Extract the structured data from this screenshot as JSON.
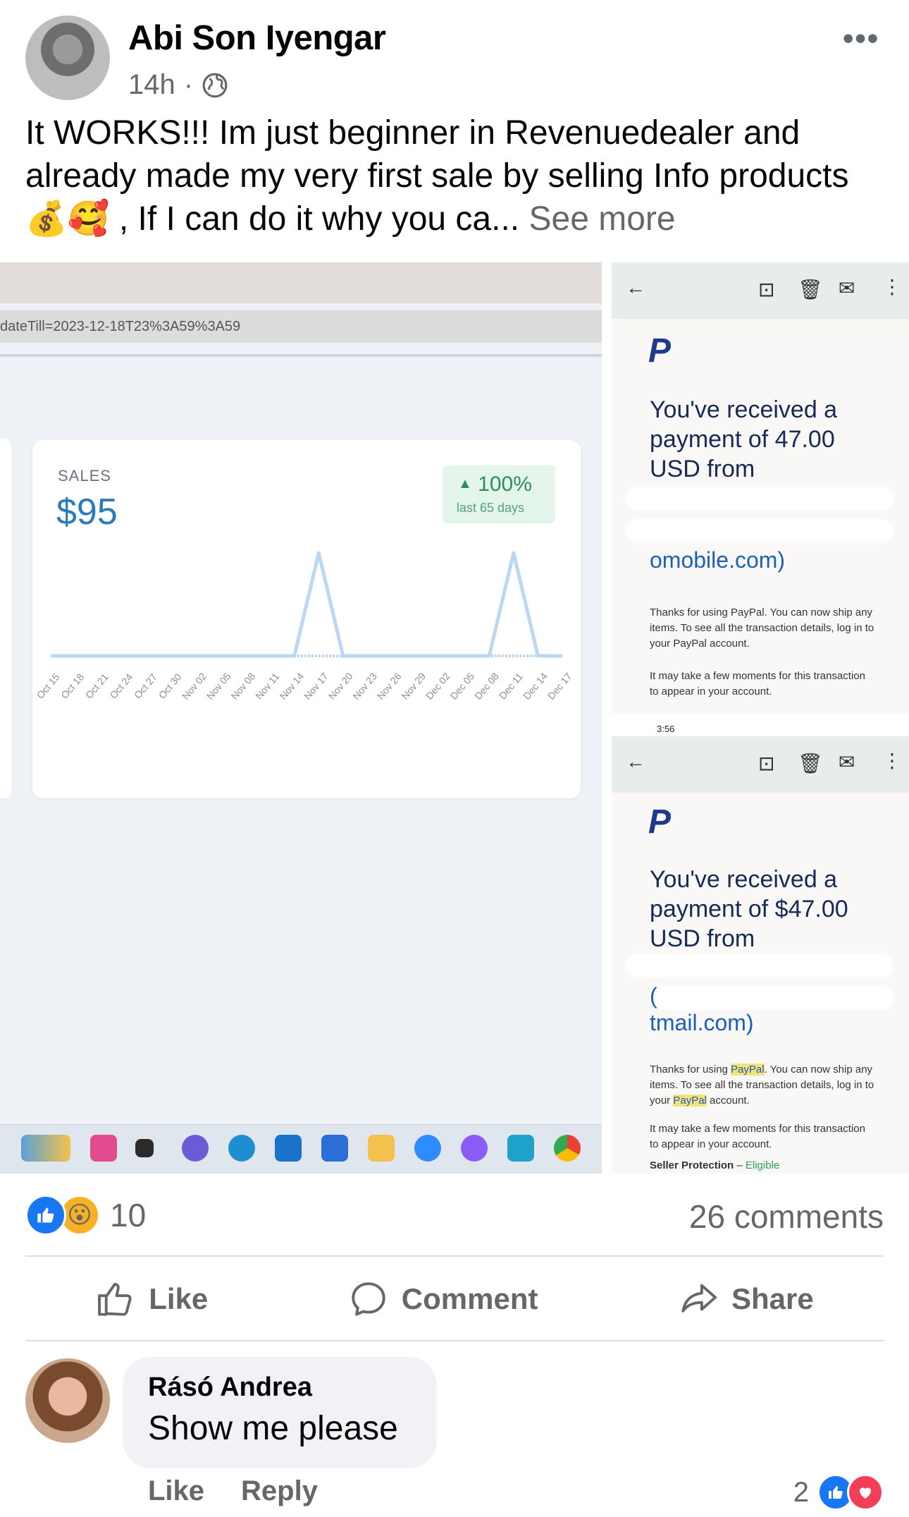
{
  "post": {
    "author": "Abi Son Iyengar",
    "time": "14h",
    "separator": "·",
    "more": "•••",
    "text": "It WORKS!!! Im just beginner in Revenuedealer and already made my very first sale by selling Info products 💰🥰 , If I can do it why you ca...",
    "see_more": "See more"
  },
  "screenshot_left": {
    "url_text": "dateTill=2023-12-18T23%3A59%3A59",
    "sales_label": "SALES",
    "sales_value": "$95",
    "change_pct": "100%",
    "change_period": "last 65 days"
  },
  "chart_data": {
    "type": "line",
    "title": "",
    "x": [
      "Oct 15",
      "Oct 18",
      "Oct 21",
      "Oct 24",
      "Oct 27",
      "Oct 30",
      "Nov 02",
      "Nov 05",
      "Nov 08",
      "Nov 11",
      "Nov 14",
      "Nov 17",
      "Nov 20",
      "Nov 23",
      "Nov 26",
      "Nov 29",
      "Dec 02",
      "Dec 05",
      "Dec 08",
      "Dec 11",
      "Dec 14",
      "Dec 17"
    ],
    "series": [
      {
        "values": [
          0,
          0,
          0,
          0,
          0,
          0,
          0,
          0,
          0,
          0,
          0,
          1,
          0,
          0,
          0,
          0,
          0,
          0,
          0,
          1,
          0,
          0
        ]
      }
    ],
    "color": "#bcd7f2"
  },
  "email1": {
    "heading": "You've received a payment of 47.00 USD from",
    "link_text": "omobile.com)",
    "body1": "Thanks for using PayPal. You can now ship any items. To see all the transaction details, log in to your PayPal account.",
    "body2": "It may take a few moments for this transaction to appear in your account."
  },
  "email2": {
    "status_time": "3:56",
    "heading": "You've received a payment of $47.00 USD from",
    "paren": "(",
    "link_text": "tmail.com)",
    "body1_a": "Thanks for using ",
    "body1_hl": "PayPal",
    "body1_b": ". You can now ship any items. To see all the transaction details, log in to your ",
    "body1_hl2": "PayPal",
    "body1_c": " account.",
    "body2": "It may take a few moments for this transaction to appear in your account.",
    "seller_label": "Seller Protection",
    "seller_dash": " – ",
    "seller_status": "Eligible"
  },
  "reactions": {
    "count": "10",
    "comments": "26 comments"
  },
  "actions": {
    "like": "Like",
    "comment": "Comment",
    "share": "Share"
  },
  "comment": {
    "name": "Rásó Andrea",
    "text": "Show me please",
    "like": "Like",
    "reply": "Reply",
    "reaction_count": "2"
  },
  "colors": {
    "fb_blue": "#1877f2",
    "muted": "#65676b",
    "paypal": "#1f3a8a"
  }
}
